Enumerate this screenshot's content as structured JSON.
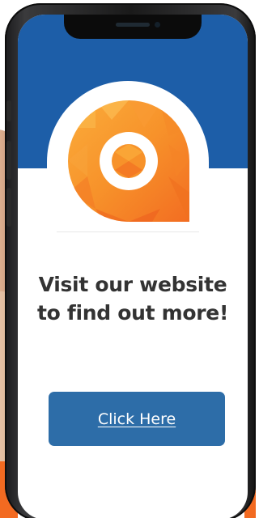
{
  "screen": {
    "headline_line1": "Visit our website",
    "headline_line2": "to find out more!",
    "cta_label": "Click Here"
  },
  "logo": {
    "icon": "orange-a-logo-icon",
    "primary_color": "#f57c1f",
    "secondary_color": "#fbae3c"
  },
  "colors": {
    "header_band": "#1d5ea8",
    "button": "#2d6da8",
    "button_text": "#ffffff",
    "headline_text": "#333333",
    "background": "#ffffff"
  }
}
